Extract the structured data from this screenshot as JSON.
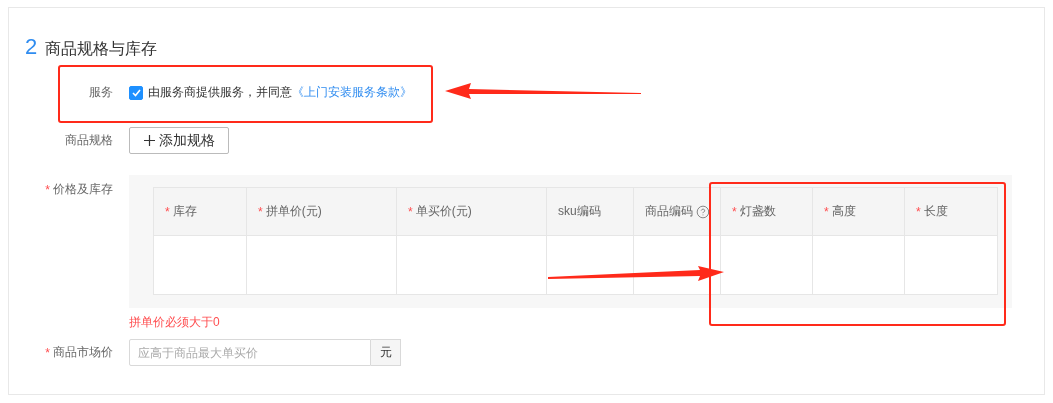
{
  "section": {
    "number": "2",
    "title": "商品规格与库存"
  },
  "service": {
    "label": "服务",
    "checked": true,
    "text": "由服务商提供服务，并同意",
    "link": "《上门安装服务条款》"
  },
  "spec": {
    "label": "商品规格",
    "button": "添加规格"
  },
  "price_stock": {
    "label": "价格及库存",
    "mark": "*",
    "columns": [
      {
        "label": "库存",
        "mark": "*",
        "help": false
      },
      {
        "label": "拼单价(元)",
        "mark": "*",
        "help": false
      },
      {
        "label": "单买价(元)",
        "mark": "*",
        "help": false
      },
      {
        "label": "sku编码",
        "help": false
      },
      {
        "label": "商品编码",
        "help": true
      },
      {
        "label": "灯盏数",
        "mark": "*",
        "help": false
      },
      {
        "label": "高度",
        "mark": "*",
        "help": false
      },
      {
        "label": "长度",
        "mark": "*",
        "help": false
      }
    ],
    "error": "拼单价必须大于0"
  },
  "market_price": {
    "label": "商品市场价",
    "mark": "*",
    "placeholder": "应高于商品最大单买价",
    "unit": "元"
  }
}
